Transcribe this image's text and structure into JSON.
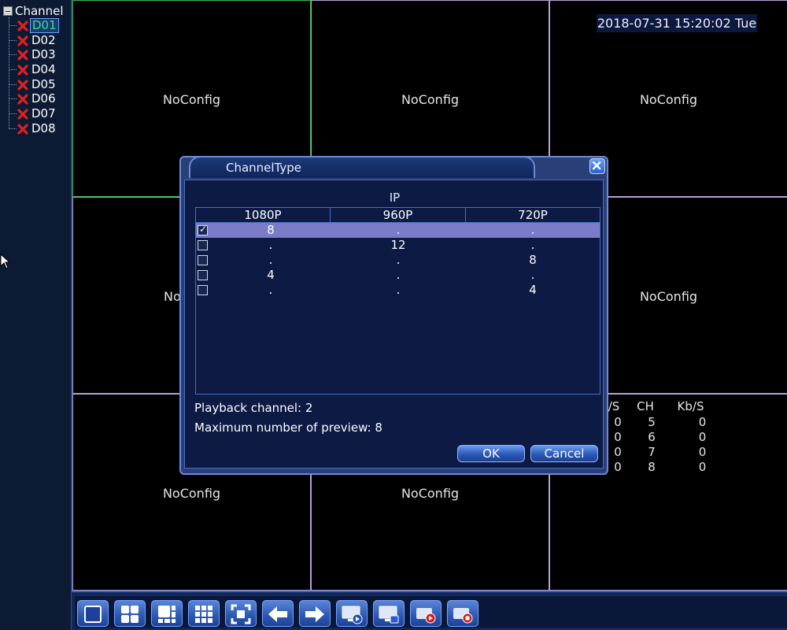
{
  "sidebar": {
    "root_label": "Channel",
    "items": [
      {
        "label": "D01",
        "selected": true
      },
      {
        "label": "D02"
      },
      {
        "label": "D03"
      },
      {
        "label": "D04"
      },
      {
        "label": "D05"
      },
      {
        "label": "D06"
      },
      {
        "label": "D07"
      },
      {
        "label": "D08"
      }
    ]
  },
  "grid": {
    "cell_label": "NoConfig",
    "cells": [
      "NoConfig",
      "NoConfig",
      "NoConfig",
      "No",
      "NoConfig",
      "NoConfig",
      "NoConfig"
    ]
  },
  "datetime": "2018-07-31 15:20:02 Tue",
  "stats": {
    "headers": [
      "/S",
      "CH",
      "Kb/S"
    ],
    "rows": [
      [
        "0",
        "5",
        "0"
      ],
      [
        "0",
        "6",
        "0"
      ],
      [
        "0",
        "7",
        "0"
      ],
      [
        "0",
        "8",
        "0"
      ]
    ]
  },
  "dialog": {
    "title": "ChannelType",
    "section_label": "IP",
    "columns": [
      "1080P",
      "960P",
      "720P"
    ],
    "rows": [
      {
        "checked": true,
        "values": [
          "8",
          ".",
          "."
        ]
      },
      {
        "checked": false,
        "values": [
          ".",
          "12",
          "."
        ]
      },
      {
        "checked": false,
        "values": [
          ".",
          ".",
          "8"
        ]
      },
      {
        "checked": false,
        "values": [
          "4",
          ".",
          "."
        ]
      },
      {
        "checked": false,
        "values": [
          ".",
          ".",
          "4"
        ]
      }
    ],
    "playback_channel": "Playback channel: 2",
    "max_preview": "Maximum number of preview: 8",
    "ok_label": "OK",
    "cancel_label": "Cancel"
  },
  "toolbar": {
    "buttons": [
      "single-view-icon",
      "quad-view-icon",
      "six-view-icon",
      "nine-view-icon",
      "fullscreen-icon",
      "previous-icon",
      "next-icon",
      "playback-icon",
      "remote-device-icon",
      "record-icon",
      "stop-record-icon"
    ]
  },
  "colors": {
    "active_cell_border": "#2fb84a",
    "cell_border": "#b9a0d9",
    "selected_row": "#7a7cc8",
    "close_x": "#e02020"
  }
}
